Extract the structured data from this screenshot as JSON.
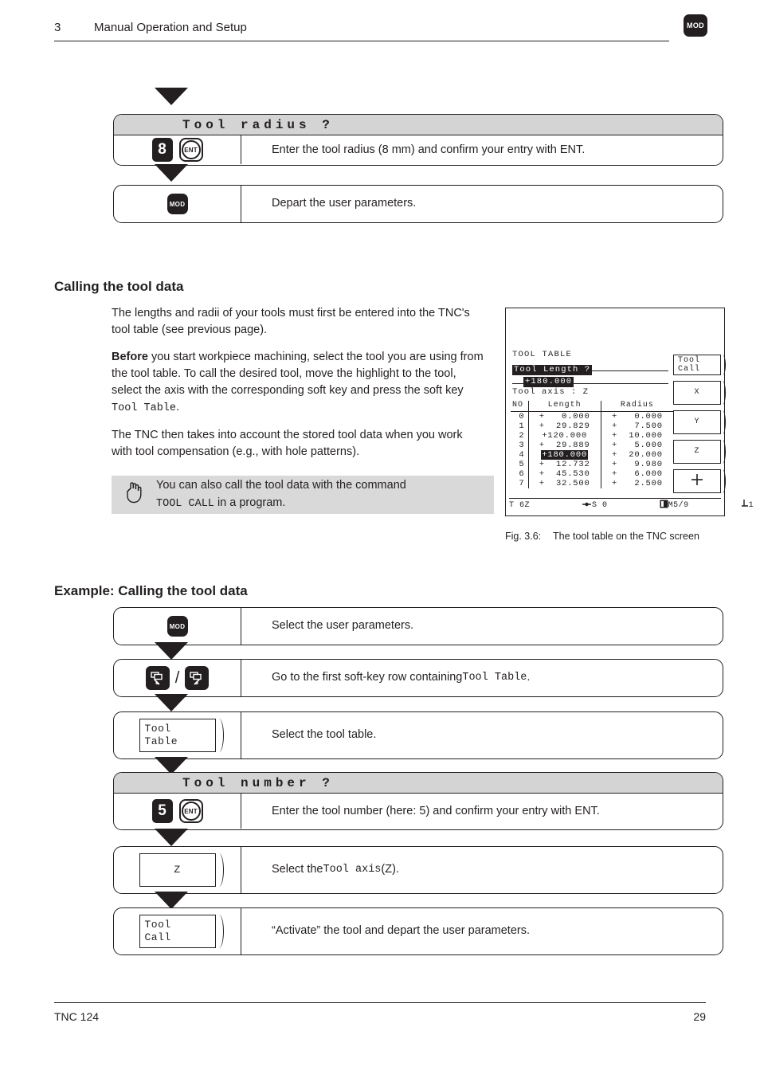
{
  "header": {
    "chapter": "3",
    "title": "Manual Operation and Setup",
    "mod_key": "MOD"
  },
  "top_steps": {
    "prompt": "Tool radius  ?",
    "rows": [
      {
        "keys": [
          "8",
          "ENT"
        ],
        "text": "Enter the tool radius (8 mm) and confirm your entry with ENT."
      },
      {
        "keys": [
          "MOD"
        ],
        "text": "Depart the user parameters."
      }
    ]
  },
  "section": {
    "heading": "Calling the tool data",
    "p1": "The lengths and radii of your tools must first be entered into the TNC's tool table (see previous page).",
    "p2_bold": "Before",
    "p2a": " you start workpiece machining, select the tool you are using from the tool table. To call the desired tool, move the highlight to the tool, select the axis with the corresponding soft key and press the soft key ",
    "p2_mono": "Tool Table",
    "p2b": ".",
    "p3": "The TNC then takes into account the stored tool data when you work with tool compensation (e.g., with hole patterns)."
  },
  "note": {
    "icon": "pointing-hand-icon",
    "line1": "You can also call the tool data with the command",
    "mono": "TOOL CALL",
    "line2": " in a program."
  },
  "figure": {
    "caption_label": "Fig. 3.6:",
    "caption_text": "The tool table on the TNC screen",
    "screen": {
      "title": "TOOL TABLE",
      "prompt": "Tool Length ?",
      "value": "+180.000",
      "axis_line": "Tool axis : Z",
      "columns": [
        "NO",
        "Length",
        "Radius"
      ],
      "rows": [
        {
          "no": "0",
          "length": "+   0.000",
          "radius": "+   0.000",
          "selected": false
        },
        {
          "no": "1",
          "length": "+  29.829",
          "radius": "+   7.500",
          "selected": false
        },
        {
          "no": "2",
          "length": "+120.000",
          "radius": "+  10.000",
          "selected": false
        },
        {
          "no": "3",
          "length": "+  29.889",
          "radius": "+   5.000",
          "selected": false
        },
        {
          "no": "4",
          "length": "+180.000",
          "radius": "+  20.000",
          "selected": true
        },
        {
          "no": "5",
          "length": "+  12.732",
          "radius": "+   9.980",
          "selected": false
        },
        {
          "no": "6",
          "length": "+  45.530",
          "radius": "+   6.000",
          "selected": false
        },
        {
          "no": "7",
          "length": "+  32.500",
          "radius": "+   2.500",
          "selected": false
        }
      ],
      "status": {
        "tool": "T 6",
        "axis": "Z",
        "spindle": "S 0",
        "misc": "M5/9",
        "datum": "1"
      },
      "softkeys": [
        {
          "line1": "Tool",
          "line2": "Call"
        },
        {
          "line1": "X",
          "line2": ""
        },
        {
          "line1": "Y",
          "line2": ""
        },
        {
          "line1": "Z",
          "line2": ""
        },
        {
          "line1": "+",
          "line2": ""
        }
      ]
    }
  },
  "example": {
    "heading": "Example: Calling the tool data",
    "steps": [
      {
        "key_type": "mod",
        "key_label": "MOD",
        "text": "Select the user parameters."
      },
      {
        "key_type": "shift",
        "key_label": "/",
        "text_a": "Go to the first soft-key row containing ",
        "text_mono": "Tool Table",
        "text_b": "."
      },
      {
        "key_type": "softkey",
        "line1": "Tool",
        "line2": "Table",
        "text": "Select the tool table."
      }
    ],
    "prompt": "Tool number ?",
    "prompt_row": {
      "keys": [
        "5",
        "ENT"
      ],
      "text": "Enter the tool number (here: 5) and confirm your entry with ENT."
    },
    "steps2": [
      {
        "key_type": "softkey",
        "line1": "Z",
        "line2": "",
        "text_a": "Select the ",
        "text_mono": "Tool axis",
        "text_b": " (Z)."
      },
      {
        "key_type": "softkey",
        "line1": "Tool",
        "line2": "Call",
        "text": "“Activate” the tool and depart the user parameters."
      }
    ]
  },
  "footer": {
    "left": "TNC 124",
    "page": "29"
  }
}
